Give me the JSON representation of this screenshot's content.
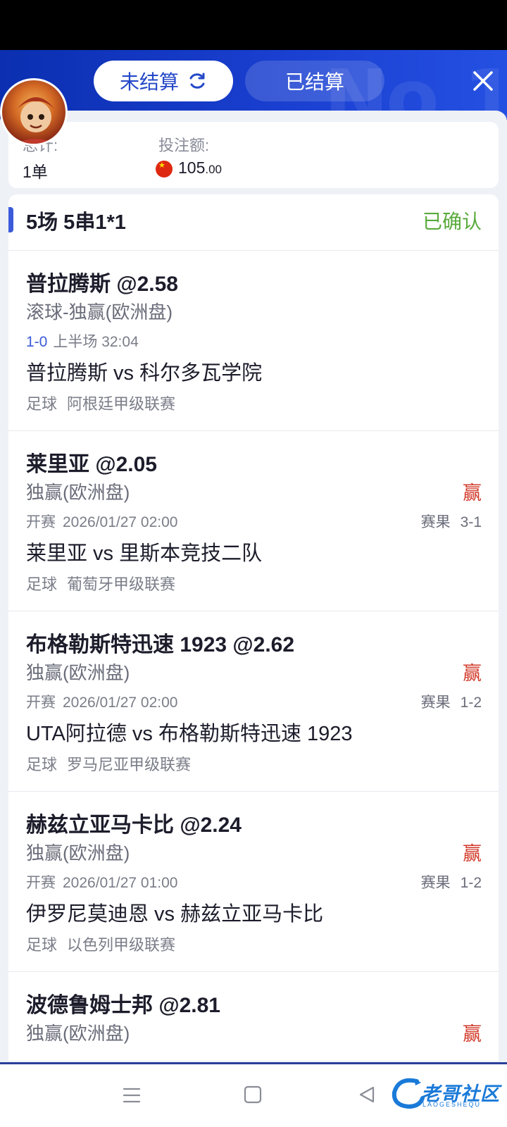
{
  "header": {
    "tabs": [
      {
        "label": "未结算",
        "active": true
      },
      {
        "label": "已结算",
        "active": false
      }
    ],
    "accent_color": "#1a3fd0"
  },
  "summary": {
    "count_label": "总计:",
    "count_value": "1单",
    "amount_label": "投注额:",
    "amount_main": "105",
    "amount_decimal": ".00",
    "currency_flag": "china-flag-icon"
  },
  "bet": {
    "type": "5场 5串1*1",
    "status": "已确认",
    "status_color": "#5aaa3c",
    "legs": [
      {
        "selection": "普拉腾斯 @2.58",
        "market": "滚球-独赢(欧洲盘)",
        "live_score": "1-0",
        "period": "上半场 32:04",
        "match": "普拉腾斯 vs 科尔多瓦学院",
        "sport": "足球",
        "league": "阿根廷甲级联赛"
      },
      {
        "selection": "莱里亚 @2.05",
        "market": "独赢(欧洲盘)",
        "badge": "赢",
        "start_label": "开赛",
        "start_time": "2026/01/27 02:00",
        "result_label": "赛果",
        "result_value": "3-1",
        "match": "莱里亚 vs 里斯本竞技二队",
        "sport": "足球",
        "league": "葡萄牙甲级联赛"
      },
      {
        "selection": "布格勒斯特迅速 1923 @2.62",
        "market": "独赢(欧洲盘)",
        "badge": "赢",
        "start_label": "开赛",
        "start_time": "2026/01/27 02:00",
        "result_label": "赛果",
        "result_value": "1-2",
        "match": "UTA阿拉德 vs 布格勒斯特迅速 1923",
        "sport": "足球",
        "league": "罗马尼亚甲级联赛"
      },
      {
        "selection": "赫兹立亚马卡比 @2.24",
        "market": "独赢(欧洲盘)",
        "badge": "赢",
        "start_label": "开赛",
        "start_time": "2026/01/27 01:00",
        "result_label": "赛果",
        "result_value": "1-2",
        "match": "伊罗尼莫迪恩 vs 赫兹立亚马卡比",
        "sport": "足球",
        "league": "以色列甲级联赛"
      },
      {
        "selection": "波德鲁姆士邦 @2.81",
        "market": "独赢(欧洲盘)",
        "badge": "赢"
      }
    ]
  },
  "watermark": {
    "text": "老哥社区",
    "sub": "LAOGESHEQU"
  }
}
